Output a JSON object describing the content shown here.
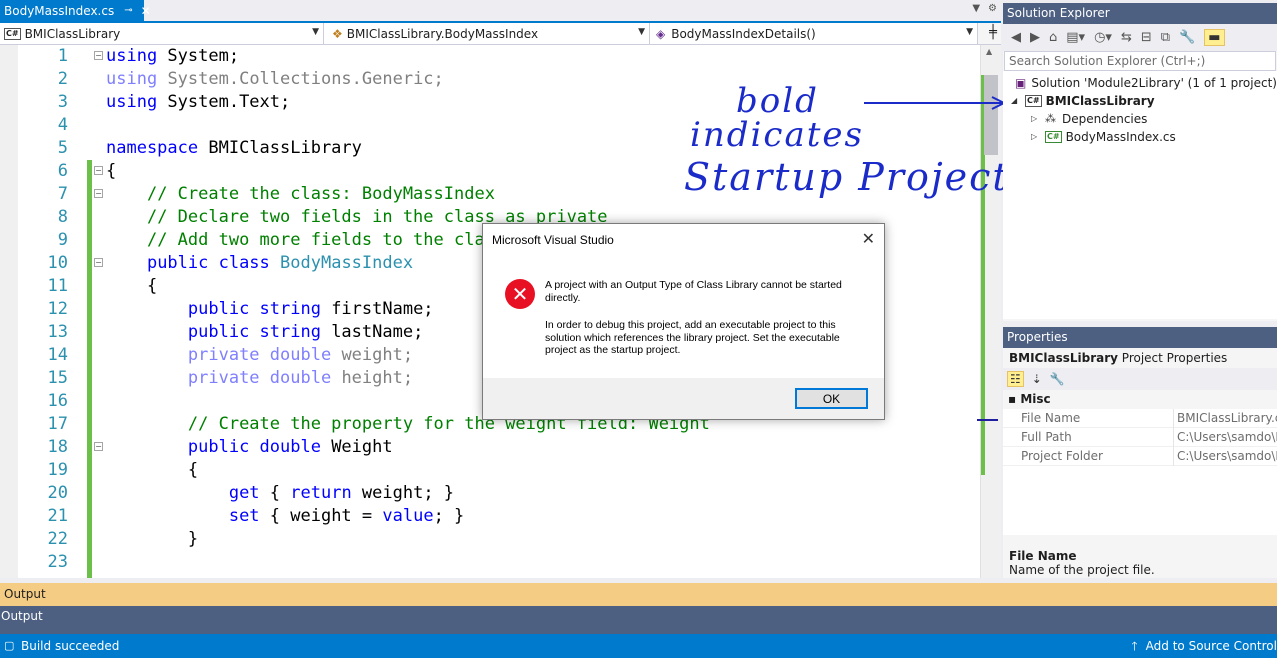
{
  "document_tab": {
    "title": "BodyMassIndex.cs",
    "pin": "⊸",
    "close": "✕"
  },
  "navbar": {
    "project": "BMIClassLibrary",
    "class": "BMIClassLibrary.BodyMassIndex",
    "member": "BodyMassIndexDetails()"
  },
  "code_lines": [
    {
      "n": "1",
      "html": "<span class='kw'>using</span> System;"
    },
    {
      "n": "2",
      "html": "<span class='dimkw'>using</span> <span class='dim'>System.Collections.Generic;</span>"
    },
    {
      "n": "3",
      "html": "<span class='kw'>using</span> System.Text;"
    },
    {
      "n": "4",
      "html": ""
    },
    {
      "n": "5",
      "html": "<span class='kw'>namespace</span> BMIClassLibrary"
    },
    {
      "n": "6",
      "html": "{"
    },
    {
      "n": "7",
      "html": "    <span class='cmt'>// Create the class: BodyMassIndex</span>"
    },
    {
      "n": "8",
      "html": "    <span class='cmt'>// Declare two fields in the class as private</span>"
    },
    {
      "n": "9",
      "html": "    <span class='cmt'>// Add two more fields to the class</span>"
    },
    {
      "n": "10",
      "html": "    <span class='kw'>public class</span> <span class='type'>BodyMassIndex</span>"
    },
    {
      "n": "11",
      "html": "    {"
    },
    {
      "n": "12",
      "html": "        <span class='kw'>public string</span> firstName;"
    },
    {
      "n": "13",
      "html": "        <span class='kw'>public string</span> lastName;"
    },
    {
      "n": "14",
      "html": "        <span class='dimkw'>private double</span> <span class='dim'>weight;</span>"
    },
    {
      "n": "15",
      "html": "        <span class='dimkw'>private double</span> <span class='dim'>height;</span>"
    },
    {
      "n": "16",
      "html": ""
    },
    {
      "n": "17",
      "html": "        <span class='cmt'>// Create the property for the weight field: Weight</span>"
    },
    {
      "n": "18",
      "html": "        <span class='kw'>public double</span> Weight"
    },
    {
      "n": "19",
      "html": "        {"
    },
    {
      "n": "20",
      "html": "            <span class='kw'>get</span> { <span class='kw'>return</span> weight; }"
    },
    {
      "n": "21",
      "html": "            <span class='kw'>set</span> { weight = <span class='kw'>value</span>; }"
    },
    {
      "n": "22",
      "html": "        }"
    },
    {
      "n": "23",
      "html": ""
    }
  ],
  "annotation": {
    "line1": "bold",
    "line2": "indicates",
    "line3": "Startup Project"
  },
  "dialog": {
    "title": "Microsoft Visual Studio",
    "message1": "A project with an Output Type of Class Library cannot be started directly.",
    "message2": "In order to debug this project, add an executable project to this solution which references the library project. Set the executable project as the startup project.",
    "ok": "OK"
  },
  "solution_explorer": {
    "title": "Solution Explorer",
    "search_placeholder": "Search Solution Explorer (Ctrl+;)",
    "solution": "Solution 'Module2Library' (1 of 1 project)",
    "project": "BMIClassLibrary",
    "dependencies": "Dependencies",
    "file": "BodyMassIndex.cs"
  },
  "properties": {
    "title": "Properties",
    "object_name": "BMIClassLibrary",
    "object_type": "Project Properties",
    "category": "Misc",
    "rows": [
      {
        "name": "File Name",
        "value": "BMIClassLibrary.csproj"
      },
      {
        "name": "Full Path",
        "value": "C:\\Users\\samdo\\Do"
      },
      {
        "name": "Project Folder",
        "value": "C:\\Users\\samdo\\Do"
      }
    ],
    "desc_title": "File Name",
    "desc_text": "Name of the project file."
  },
  "output": {
    "autohide_label": "Output",
    "tab_label": "Output"
  },
  "status": {
    "text": "Build succeeded",
    "source_control": "Add to Source Control"
  },
  "colors": {
    "accent": "#007ACC",
    "panel_title": "#4D6082",
    "error": "#E81123",
    "annotation": "#1A2BC9"
  }
}
